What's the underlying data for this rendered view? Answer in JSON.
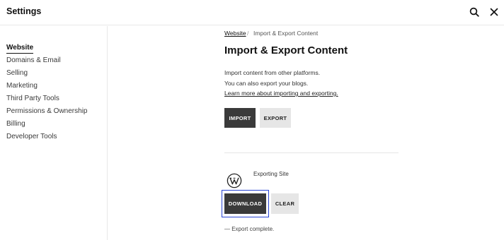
{
  "header": {
    "title": "Settings",
    "search_icon": "search-icon",
    "close_icon": "close-icon"
  },
  "sidebar": {
    "items": [
      {
        "label": "Website",
        "active": true
      },
      {
        "label": "Domains & Email",
        "active": false
      },
      {
        "label": "Selling",
        "active": false
      },
      {
        "label": "Marketing",
        "active": false
      },
      {
        "label": "Third Party Tools",
        "active": false
      },
      {
        "label": "Permissions & Ownership",
        "active": false
      },
      {
        "label": "Billing",
        "active": false
      },
      {
        "label": "Developer Tools",
        "active": false
      }
    ]
  },
  "breadcrumb": {
    "link": "Website",
    "separator": "/",
    "current": "Import & Export Content"
  },
  "main": {
    "title": "Import & Export Content",
    "description_line_1": "Import content from other platforms.",
    "description_line_2": "You can also export your blogs.",
    "learn_more_link": "Learn more about importing and exporting.",
    "import_button": "IMPORT",
    "export_button": "EXPORT"
  },
  "export_job": {
    "icon": "wordpress-icon",
    "label": "Exporting Site",
    "download_button": "DOWNLOAD",
    "clear_button": "CLEAR",
    "status": "— Export complete."
  },
  "colors": {
    "dark_button": "#3a3a3a",
    "light_button": "#e6e6e6",
    "focus_ring": "#2743d4"
  }
}
